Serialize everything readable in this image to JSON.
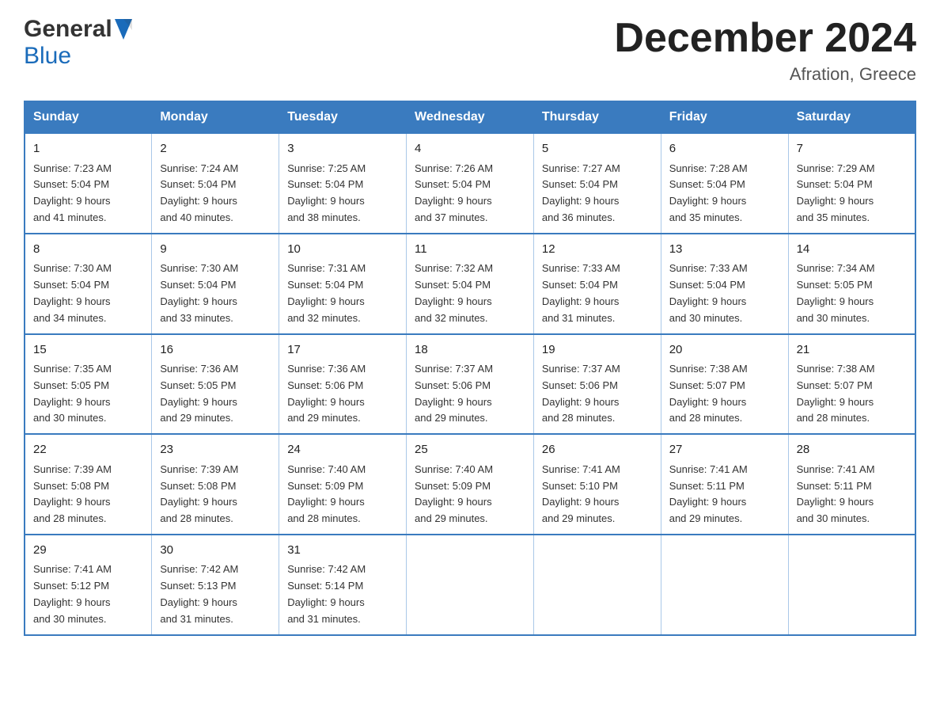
{
  "header": {
    "logo_general": "General",
    "logo_blue": "Blue",
    "month_title": "December 2024",
    "location": "Afration, Greece"
  },
  "calendar": {
    "days_of_week": [
      "Sunday",
      "Monday",
      "Tuesday",
      "Wednesday",
      "Thursday",
      "Friday",
      "Saturday"
    ],
    "weeks": [
      [
        {
          "day": "1",
          "sunrise": "7:23 AM",
          "sunset": "5:04 PM",
          "daylight": "9 hours and 41 minutes."
        },
        {
          "day": "2",
          "sunrise": "7:24 AM",
          "sunset": "5:04 PM",
          "daylight": "9 hours and 40 minutes."
        },
        {
          "day": "3",
          "sunrise": "7:25 AM",
          "sunset": "5:04 PM",
          "daylight": "9 hours and 38 minutes."
        },
        {
          "day": "4",
          "sunrise": "7:26 AM",
          "sunset": "5:04 PM",
          "daylight": "9 hours and 37 minutes."
        },
        {
          "day": "5",
          "sunrise": "7:27 AM",
          "sunset": "5:04 PM",
          "daylight": "9 hours and 36 minutes."
        },
        {
          "day": "6",
          "sunrise": "7:28 AM",
          "sunset": "5:04 PM",
          "daylight": "9 hours and 35 minutes."
        },
        {
          "day": "7",
          "sunrise": "7:29 AM",
          "sunset": "5:04 PM",
          "daylight": "9 hours and 35 minutes."
        }
      ],
      [
        {
          "day": "8",
          "sunrise": "7:30 AM",
          "sunset": "5:04 PM",
          "daylight": "9 hours and 34 minutes."
        },
        {
          "day": "9",
          "sunrise": "7:30 AM",
          "sunset": "5:04 PM",
          "daylight": "9 hours and 33 minutes."
        },
        {
          "day": "10",
          "sunrise": "7:31 AM",
          "sunset": "5:04 PM",
          "daylight": "9 hours and 32 minutes."
        },
        {
          "day": "11",
          "sunrise": "7:32 AM",
          "sunset": "5:04 PM",
          "daylight": "9 hours and 32 minutes."
        },
        {
          "day": "12",
          "sunrise": "7:33 AM",
          "sunset": "5:04 PM",
          "daylight": "9 hours and 31 minutes."
        },
        {
          "day": "13",
          "sunrise": "7:33 AM",
          "sunset": "5:04 PM",
          "daylight": "9 hours and 30 minutes."
        },
        {
          "day": "14",
          "sunrise": "7:34 AM",
          "sunset": "5:05 PM",
          "daylight": "9 hours and 30 minutes."
        }
      ],
      [
        {
          "day": "15",
          "sunrise": "7:35 AM",
          "sunset": "5:05 PM",
          "daylight": "9 hours and 30 minutes."
        },
        {
          "day": "16",
          "sunrise": "7:36 AM",
          "sunset": "5:05 PM",
          "daylight": "9 hours and 29 minutes."
        },
        {
          "day": "17",
          "sunrise": "7:36 AM",
          "sunset": "5:06 PM",
          "daylight": "9 hours and 29 minutes."
        },
        {
          "day": "18",
          "sunrise": "7:37 AM",
          "sunset": "5:06 PM",
          "daylight": "9 hours and 29 minutes."
        },
        {
          "day": "19",
          "sunrise": "7:37 AM",
          "sunset": "5:06 PM",
          "daylight": "9 hours and 28 minutes."
        },
        {
          "day": "20",
          "sunrise": "7:38 AM",
          "sunset": "5:07 PM",
          "daylight": "9 hours and 28 minutes."
        },
        {
          "day": "21",
          "sunrise": "7:38 AM",
          "sunset": "5:07 PM",
          "daylight": "9 hours and 28 minutes."
        }
      ],
      [
        {
          "day": "22",
          "sunrise": "7:39 AM",
          "sunset": "5:08 PM",
          "daylight": "9 hours and 28 minutes."
        },
        {
          "day": "23",
          "sunrise": "7:39 AM",
          "sunset": "5:08 PM",
          "daylight": "9 hours and 28 minutes."
        },
        {
          "day": "24",
          "sunrise": "7:40 AM",
          "sunset": "5:09 PM",
          "daylight": "9 hours and 28 minutes."
        },
        {
          "day": "25",
          "sunrise": "7:40 AM",
          "sunset": "5:09 PM",
          "daylight": "9 hours and 29 minutes."
        },
        {
          "day": "26",
          "sunrise": "7:41 AM",
          "sunset": "5:10 PM",
          "daylight": "9 hours and 29 minutes."
        },
        {
          "day": "27",
          "sunrise": "7:41 AM",
          "sunset": "5:11 PM",
          "daylight": "9 hours and 29 minutes."
        },
        {
          "day": "28",
          "sunrise": "7:41 AM",
          "sunset": "5:11 PM",
          "daylight": "9 hours and 30 minutes."
        }
      ],
      [
        {
          "day": "29",
          "sunrise": "7:41 AM",
          "sunset": "5:12 PM",
          "daylight": "9 hours and 30 minutes."
        },
        {
          "day": "30",
          "sunrise": "7:42 AM",
          "sunset": "5:13 PM",
          "daylight": "9 hours and 31 minutes."
        },
        {
          "day": "31",
          "sunrise": "7:42 AM",
          "sunset": "5:14 PM",
          "daylight": "9 hours and 31 minutes."
        },
        null,
        null,
        null,
        null
      ]
    ],
    "sunrise_label": "Sunrise:",
    "sunset_label": "Sunset:",
    "daylight_label": "Daylight:"
  }
}
